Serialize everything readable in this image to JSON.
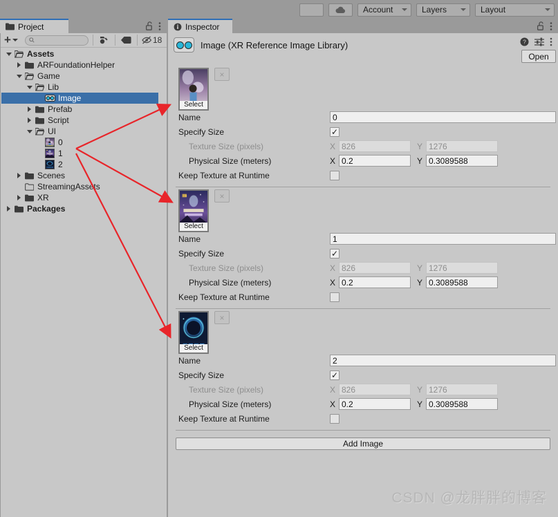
{
  "toolbar": {
    "buttons": [
      {
        "name": "collab-button",
        "label": "",
        "icon": "cloud-placeholder-icon"
      },
      {
        "name": "cloud-button",
        "label": "",
        "icon": "cloud-icon"
      }
    ],
    "dropdowns": [
      {
        "name": "account-dropdown",
        "label": "Account",
        "icon": "chevron-down-icon"
      },
      {
        "name": "layers-dropdown",
        "label": "Layers",
        "icon": "chevron-down-icon"
      },
      {
        "name": "layout-dropdown",
        "label": "Layout",
        "icon": "chevron-down-icon"
      }
    ]
  },
  "project_panel": {
    "tab_label": "Project",
    "tab_icon": "folder-icon",
    "lock_icon": "lock-open-icon",
    "menu_icon": "kebab-menu-icon",
    "toolbar": {
      "add_label": "+",
      "add_icon": "plus-icon",
      "add_caret_icon": "chevron-down-icon",
      "search_placeholder": "",
      "search_value": "",
      "search_icon": "search-icon",
      "favorite_icon": "asset-filter-icon",
      "label_icon": "tag-icon",
      "hidden_icon": "eye-off-icon",
      "hidden_count": "18"
    },
    "tree": [
      {
        "label": "Assets",
        "depth": 0,
        "arrow": "down",
        "icon": "folder-open-icon",
        "bold": true,
        "selected": false
      },
      {
        "label": "ARFoundationHelper",
        "depth": 1,
        "arrow": "right",
        "icon": "folder-icon",
        "bold": false,
        "selected": false
      },
      {
        "label": "Game",
        "depth": 1,
        "arrow": "down",
        "icon": "folder-open-icon",
        "bold": false,
        "selected": false
      },
      {
        "label": "Lib",
        "depth": 2,
        "arrow": "down",
        "icon": "folder-open-icon",
        "bold": false,
        "selected": false
      },
      {
        "label": "Image",
        "depth": 3,
        "arrow": "none",
        "icon": "xr-image-library-icon",
        "bold": false,
        "selected": true
      },
      {
        "label": "Prefab",
        "depth": 2,
        "arrow": "right",
        "icon": "folder-icon",
        "bold": false,
        "selected": false
      },
      {
        "label": "Script",
        "depth": 2,
        "arrow": "right",
        "icon": "folder-icon",
        "bold": false,
        "selected": false
      },
      {
        "label": "UI",
        "depth": 2,
        "arrow": "down",
        "icon": "folder-open-icon",
        "bold": false,
        "selected": false
      },
      {
        "label": "0",
        "depth": 3,
        "arrow": "none",
        "icon": "texture-thumb-0-icon",
        "bold": false,
        "selected": false
      },
      {
        "label": "1",
        "depth": 3,
        "arrow": "none",
        "icon": "texture-thumb-1-icon",
        "bold": false,
        "selected": false
      },
      {
        "label": "2",
        "depth": 3,
        "arrow": "none",
        "icon": "texture-thumb-2-icon",
        "bold": false,
        "selected": false
      },
      {
        "label": "Scenes",
        "depth": 1,
        "arrow": "right",
        "icon": "folder-icon",
        "bold": false,
        "selected": false
      },
      {
        "label": "StreamingAssets",
        "depth": 1,
        "arrow": "none",
        "icon": "folder-outline-icon",
        "bold": false,
        "selected": false
      },
      {
        "label": "XR",
        "depth": 1,
        "arrow": "right",
        "icon": "folder-icon",
        "bold": false,
        "selected": false
      },
      {
        "label": "Packages",
        "depth": 0,
        "arrow": "right",
        "icon": "folder-icon",
        "bold": true,
        "selected": false
      }
    ]
  },
  "inspector": {
    "tab_label": "Inspector",
    "tab_icon": "info-icon",
    "lock_icon": "lock-open-icon",
    "menu_icon": "kebab-menu-icon",
    "asset_title": "Image (XR Reference Image Library)",
    "asset_icon": "xr-reference-image-library-icon",
    "help_icon": "help-icon",
    "preset_icon": "preset-icon",
    "more_icon": "kebab-menu-icon",
    "open_button": "Open",
    "add_image_button": "Add Image",
    "field_labels": {
      "name": "Name",
      "specify_size": "Specify Size",
      "texture_size": "Texture Size (pixels)",
      "physical_size": "Physical Size (meters)",
      "keep_texture": "Keep Texture at Runtime"
    },
    "axis_x": "X",
    "axis_y": "Y",
    "select_label": "Select",
    "clear_label": "×",
    "entries": [
      {
        "thumb": "texture-thumb-0-icon",
        "name": "0",
        "specify_size": true,
        "texture_size_x": "826",
        "texture_size_y": "1276",
        "physical_size_x": "0.2",
        "physical_size_y": "0.3089588",
        "keep_texture_at_runtime": false
      },
      {
        "thumb": "texture-thumb-1-icon",
        "name": "1",
        "specify_size": true,
        "texture_size_x": "826",
        "texture_size_y": "1276",
        "physical_size_x": "0.2",
        "physical_size_y": "0.3089588",
        "keep_texture_at_runtime": false
      },
      {
        "thumb": "texture-thumb-2-icon",
        "name": "2",
        "specify_size": true,
        "texture_size_x": "826",
        "texture_size_y": "1276",
        "physical_size_x": "0.2",
        "physical_size_y": "0.3089588",
        "keep_texture_at_runtime": false
      }
    ]
  },
  "annotations": {
    "arrow_color": "#e8252a",
    "arrow_count": 3
  },
  "watermark": "CSDN @龙胖胖的博客",
  "colors": {
    "window_bg": "#9a9a9a",
    "panel_bg": "#c8c8c8",
    "selection_blue": "#3a6fa8",
    "tab_accent": "#2f6fb5",
    "field_bg": "#efefef",
    "field_readonly_bg": "#dcdcdc",
    "arrow_red": "#e8252a"
  }
}
